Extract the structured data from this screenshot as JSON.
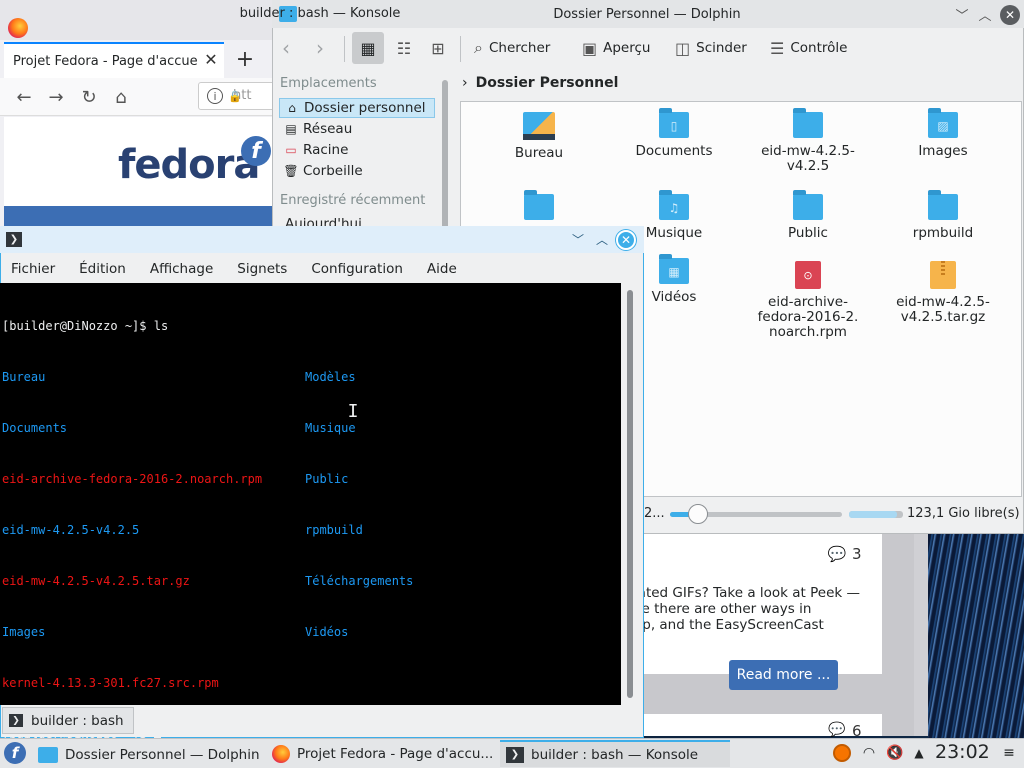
{
  "firefox": {
    "tab_title": "Projet Fedora - Page d'accue",
    "url_prefix": "htt",
    "logo_text": "fedora",
    "logo_mark": "f"
  },
  "web_page": {
    "comments_count": "3",
    "comments_count2": "6",
    "text_lines": [
      "ated GIFs? Take a look at Peek —",
      "ile there are other ways in",
      "op, and the EasyScreenCast"
    ],
    "read_more": "Read more ..."
  },
  "dolphin": {
    "title": "Dossier Personnel — Dolphin",
    "toolbar": {
      "search": "Chercher",
      "preview": "Aperçu",
      "split": "Scinder",
      "control": "Contrôle"
    },
    "places": {
      "heading": "Emplacements",
      "items": [
        {
          "label": "Dossier personnel",
          "icon": "home-icon"
        },
        {
          "label": "Réseau",
          "icon": "network-icon"
        },
        {
          "label": "Racine",
          "icon": "root-folder-icon"
        },
        {
          "label": "Corbeille",
          "icon": "trash-icon"
        }
      ],
      "recent_heading": "Enregistré récemment",
      "recent_first": "Aujourd'hui"
    },
    "breadcrumb": "Dossier Personnel",
    "files": [
      {
        "name": "Bureau",
        "type": "desktop-folder"
      },
      {
        "name": "Documents",
        "type": "folder"
      },
      {
        "name": "eid-mw-4.2.5-v4.2.5",
        "type": "folder"
      },
      {
        "name": "Images",
        "type": "folder"
      },
      {
        "name": "Musique",
        "type": "folder"
      },
      {
        "name": "Public",
        "type": "folder"
      },
      {
        "name": "rpmbuild",
        "type": "folder"
      },
      {
        "name": "Vidéos",
        "type": "folder"
      },
      {
        "name": "eid-archive-fedora-2016-2.noarch.rpm",
        "type": "rpm"
      },
      {
        "name": "eid-mw-4.2.5-v4.2.5.tar.gz",
        "type": "archive"
      }
    ],
    "status_left": "2...",
    "zoom_level": 0.1,
    "free_space": "123,1 Gio libre(s)"
  },
  "konsole": {
    "title": "builder : bash — Konsole",
    "menu": [
      "Fichier",
      "Édition",
      "Affichage",
      "Signets",
      "Configuration",
      "Aide"
    ],
    "prompt": "[builder@DiNozzo ~]$ ",
    "command": "ls",
    "ls_col1": [
      "Bureau",
      "Documents",
      "eid-archive-fedora-2016-2.noarch.rpm",
      "eid-mw-4.2.5-v4.2.5",
      "eid-mw-4.2.5-v4.2.5.tar.gz",
      "Images",
      "kernel-4.13.3-301.fc27.src.rpm"
    ],
    "ls_col2": [
      "Modèles",
      "Musique",
      "Public",
      "rpmbuild",
      "Téléchargements",
      "Vidéos"
    ],
    "tab_label": "builder : bash",
    "colors": {
      "dir": "#1d99f3",
      "file_red": "#ed1515",
      "bg": "#000000"
    }
  },
  "taskbar": {
    "tasks": [
      "Dossier Personnel — Dolphin",
      "Projet Fedora - Page d'accu...",
      "builder : bash — Konsole"
    ],
    "clock": "23:02"
  }
}
